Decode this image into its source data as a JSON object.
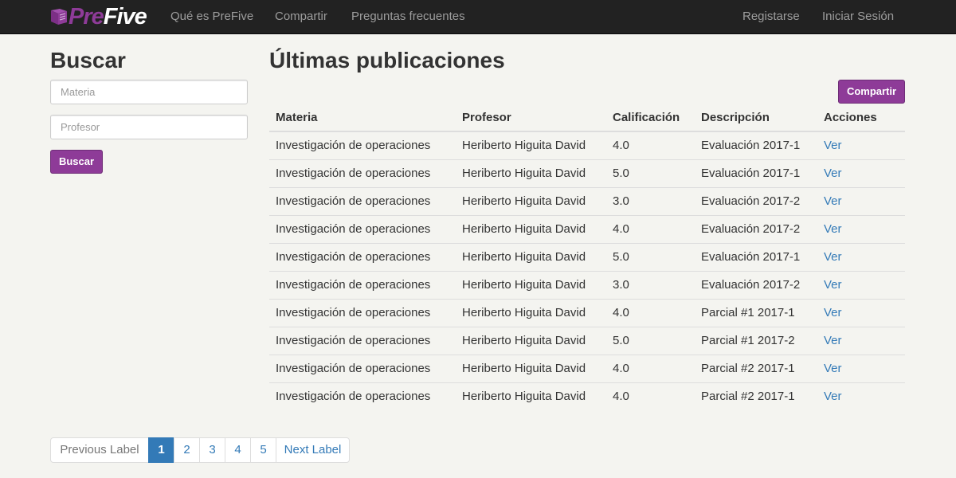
{
  "navbar": {
    "brand_pre": "Pre",
    "brand_five": "Five",
    "links": [
      "Qué es PreFive",
      "Compartir",
      "Preguntas frecuentes"
    ],
    "register": "Registarse",
    "login": "Iniciar Sesión"
  },
  "sidebar": {
    "title": "Buscar",
    "materia_placeholder": "Materia",
    "profesor_placeholder": "Profesor",
    "search_button": "Buscar"
  },
  "main": {
    "title": "Últimas publicaciones",
    "share_button": "Compartir",
    "columns": [
      "Materia",
      "Profesor",
      "Calificación",
      "Descripción",
      "Acciones"
    ],
    "rows": [
      [
        "Investigación de operaciones",
        "Heriberto Higuita David",
        "4.0",
        "Evaluación 2017-1",
        "Ver"
      ],
      [
        "Investigación de operaciones",
        "Heriberto Higuita David",
        "5.0",
        "Evaluación 2017-1",
        "Ver"
      ],
      [
        "Investigación de operaciones",
        "Heriberto Higuita David",
        "3.0",
        "Evaluación 2017-2",
        "Ver"
      ],
      [
        "Investigación de operaciones",
        "Heriberto Higuita David",
        "4.0",
        "Evaluación 2017-2",
        "Ver"
      ],
      [
        "Investigación de operaciones",
        "Heriberto Higuita David",
        "5.0",
        "Evaluación 2017-1",
        "Ver"
      ],
      [
        "Investigación de operaciones",
        "Heriberto Higuita David",
        "3.0",
        "Evaluación 2017-2",
        "Ver"
      ],
      [
        "Investigación de operaciones",
        "Heriberto Higuita David",
        "4.0",
        "Parcial #1 2017-1",
        "Ver"
      ],
      [
        "Investigación de operaciones",
        "Heriberto Higuita David",
        "5.0",
        "Parcial #1 2017-2",
        "Ver"
      ],
      [
        "Investigación de operaciones",
        "Heriberto Higuita David",
        "4.0",
        "Parcial #2 2017-1",
        "Ver"
      ],
      [
        "Investigación de operaciones",
        "Heriberto Higuita David",
        "4.0",
        "Parcial #2 2017-1",
        "Ver"
      ]
    ]
  },
  "pagination": {
    "previous": "Previous Label",
    "pages": [
      "1",
      "2",
      "3",
      "4",
      "5"
    ],
    "active_page": "1",
    "next": "Next Label"
  },
  "colors": {
    "brand_purple": "#8e3b98",
    "navbar_bg": "#222222",
    "link_blue": "#337ab7",
    "page_bg": "#f4f4f0"
  },
  "icons": {
    "logo": "book-logo-icon"
  }
}
